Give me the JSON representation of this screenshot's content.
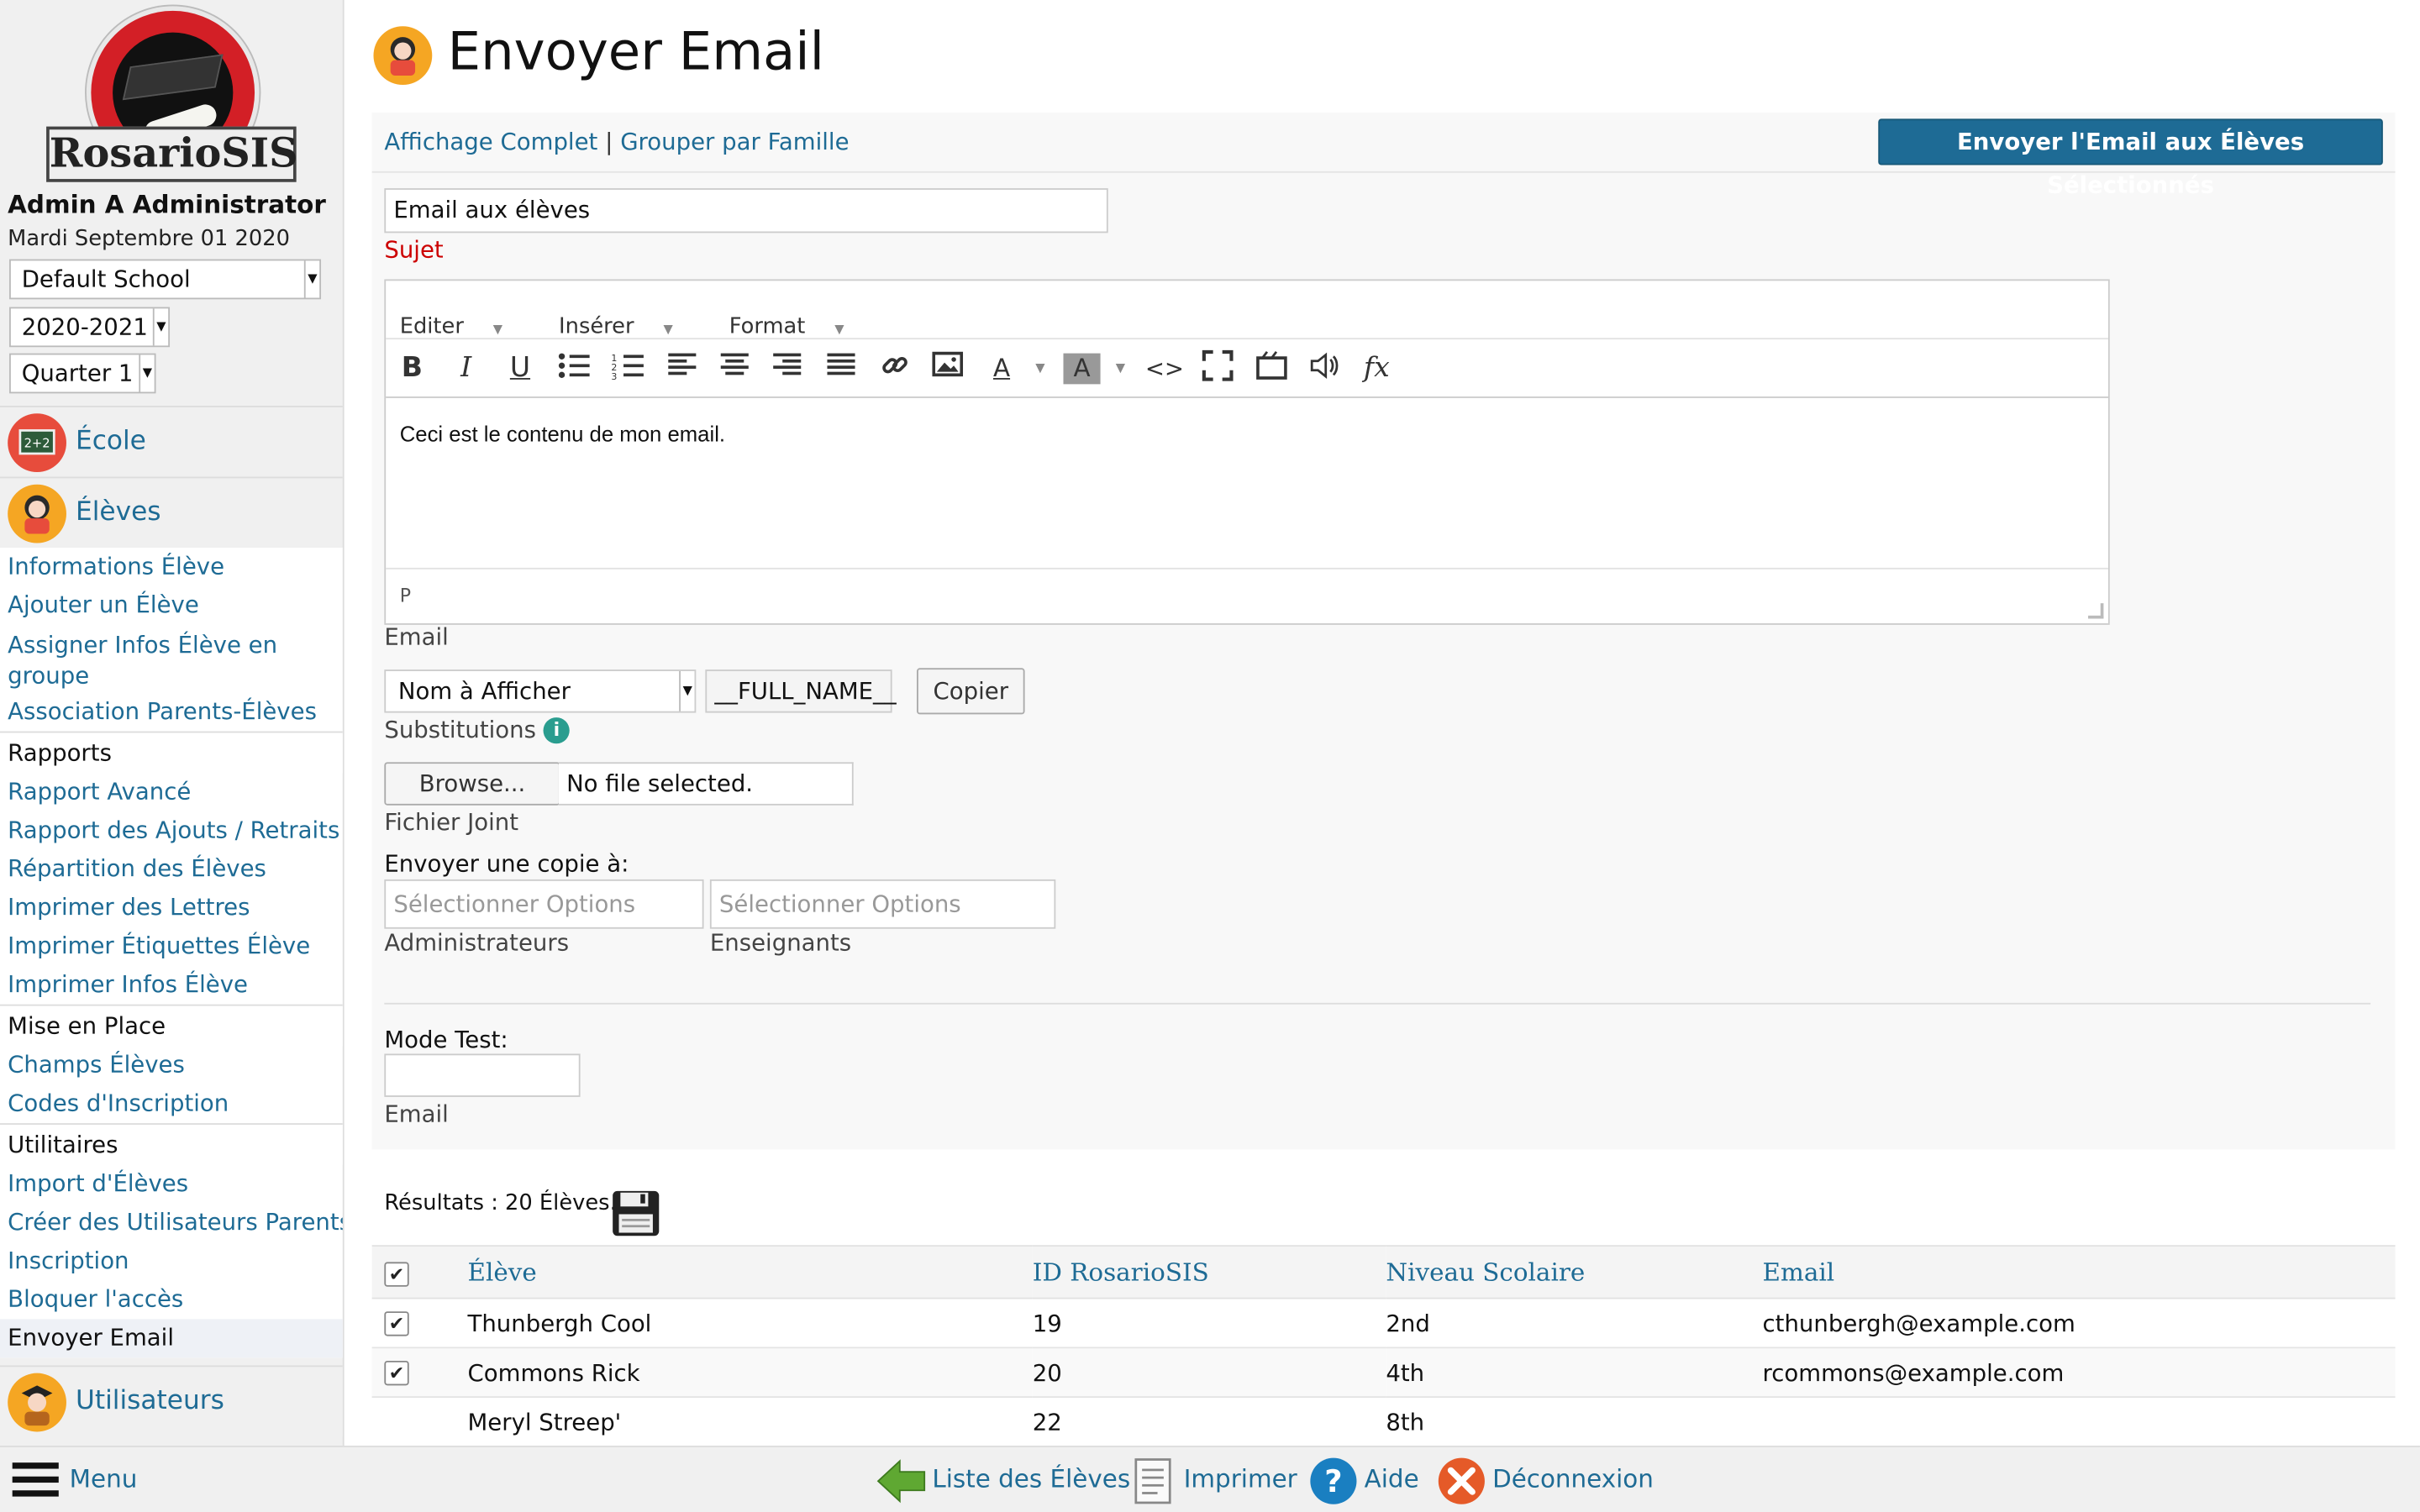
{
  "app": {
    "logo_text": "RosarioSIS",
    "user": "Admin A Administrator",
    "date": "Mardi Septembre 01 2020",
    "school": "Default School",
    "year": "2020-2021",
    "quarter": "Quarter 1"
  },
  "sidebar": {
    "modules": [
      {
        "label": "École",
        "icon": "school-board-icon",
        "color": "#e74c3c"
      },
      {
        "label": "Élèves",
        "icon": "student-icon",
        "color": "#f5a623"
      },
      {
        "label": "Utilisateurs",
        "icon": "user-icon",
        "color": "#f5a623"
      }
    ],
    "items": [
      {
        "label": "Informations Élève"
      },
      {
        "label": "Ajouter un Élève"
      },
      {
        "label": "Assigner Infos Élève en groupe"
      },
      {
        "label": "Association Parents-Élèves"
      }
    ],
    "header_reports": "Rapports",
    "reports": [
      {
        "label": "Rapport Avancé"
      },
      {
        "label": "Rapport des Ajouts / Retraits"
      },
      {
        "label": "Répartition des Élèves"
      },
      {
        "label": "Imprimer des Lettres"
      },
      {
        "label": "Imprimer Étiquettes Élève"
      },
      {
        "label": "Imprimer Infos Élève"
      }
    ],
    "header_setup": "Mise en Place",
    "setup": [
      {
        "label": "Champs Élèves"
      },
      {
        "label": "Codes d'Inscription"
      }
    ],
    "header_utils": "Utilitaires",
    "utils": [
      {
        "label": "Import d'Élèves"
      },
      {
        "label": "Créer des Utilisateurs Parents"
      },
      {
        "label": "Inscription"
      },
      {
        "label": "Bloquer l'accès"
      },
      {
        "label": "Envoyer Email"
      }
    ]
  },
  "main": {
    "title": "Envoyer Email",
    "link_full": "Affichage Complet",
    "link_sep": "|",
    "link_family": "Grouper par Famille",
    "send_button": "Envoyer l'Email aux Élèves Sélectionnés",
    "subject_value": "Email aux élèves",
    "subject_label": "Sujet",
    "editor": {
      "menus": [
        "Editer",
        "Insérer",
        "Format"
      ],
      "content": "Ceci est le contenu de mon email.",
      "status": "P"
    },
    "email_label": "Email",
    "substitution_select": "Nom à Afficher",
    "substitution_token": "__FULL_NAME__",
    "copy_button": "Copier",
    "substitutions_label": "Substitutions",
    "browse_button": "Browse...",
    "no_file": "No file selected.",
    "attachment_label": "Fichier Joint",
    "cc_label": "Envoyer une copie à:",
    "admins_placeholder": "Sélectionner Options",
    "admins_label": "Administrateurs",
    "teachers_placeholder": "Sélectionner Options",
    "teachers_label": "Enseignants",
    "test_mode_label": "Mode Test:",
    "test_email_label": "Email"
  },
  "results": {
    "summary": "Résultats : 20 Élèves.",
    "columns": [
      "Élève",
      "ID RosarioSIS",
      "Niveau Scolaire",
      "Email"
    ],
    "rows": [
      {
        "checked": "✔",
        "name": "Thunbergh Cool",
        "id": "19",
        "grade": "2nd",
        "email": "cthunbergh@example.com"
      },
      {
        "checked": "✔",
        "name": "Commons Rick",
        "id": "20",
        "grade": "4th",
        "email": "rcommons@example.com"
      },
      {
        "checked": "",
        "name": "Meryl Streep'",
        "id": "22",
        "grade": "8th",
        "email": ""
      }
    ]
  },
  "bottombar": {
    "menu": "Menu",
    "list": "Liste des Élèves",
    "print": "Imprimer",
    "help": "Aide",
    "logout": "Déconnexion"
  }
}
